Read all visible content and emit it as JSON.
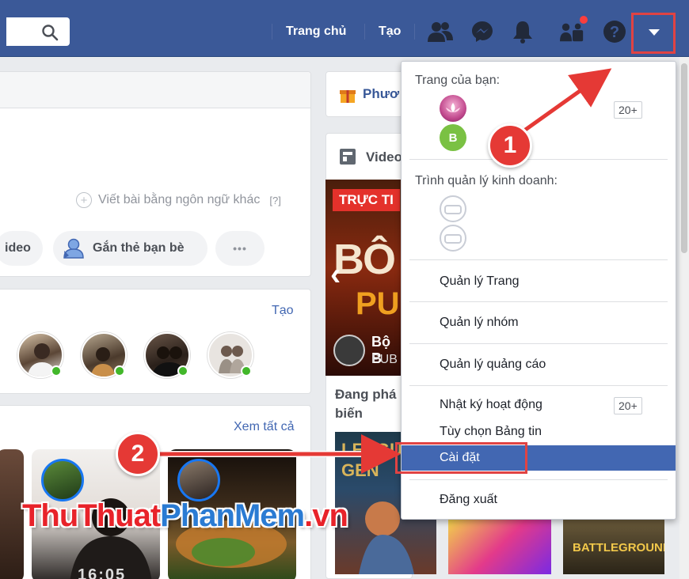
{
  "header": {
    "nav_home": "Trang chủ",
    "nav_create": "Tạo"
  },
  "composer": {
    "other_language": "Viết bài bằng ngôn ngữ khác",
    "help": "[?]",
    "video_partial": "ideo",
    "tag_friends": "Gắn thẻ bạn bè",
    "more": "•••"
  },
  "contacts": {
    "create_link": "Tạo"
  },
  "stories": {
    "see_all": "Xem tất cả",
    "timer_partial": "16:05"
  },
  "right_column": {
    "card1_title_partial": "Phươ",
    "card2_title_partial": "Video",
    "live_tag": "TRỰC TI",
    "live_title_partial": "BÔ B",
    "live_title_line2": "PU",
    "channel_partial": "Bộ B",
    "channel_sub_partial": "PUB",
    "trending_title": "Đang phá",
    "trending_title_line2": "biến"
  },
  "dropdown": {
    "your_pages_header": "Trang của bạn:",
    "page_count": "20+",
    "page2_initial": "B",
    "business_header": "Trình quản lý kinh doanh:",
    "items": [
      {
        "label": "Quản lý Trang"
      },
      {
        "label": "Quản lý nhóm"
      },
      {
        "label": "Quản lý quảng cáo"
      },
      {
        "label": "Nhật ký hoạt động"
      },
      {
        "label": "Tùy chọn Bảng tin"
      },
      {
        "label": "Cài đặt"
      },
      {
        "label": "Đăng xuất"
      }
    ],
    "activity_count": "20+"
  },
  "annotations": {
    "step1": "1",
    "step2": "2"
  },
  "watermark": {
    "part1": "ThuThuat",
    "part2": "PhanMem",
    "part3": ".vn"
  },
  "thumbnails": {
    "game3_title": "BATTLEGROUNDS",
    "game1_title_partial": "LEAGUE GEN"
  },
  "colors": {
    "brand": "#3b5998",
    "highlight": "#e04343",
    "active_item": "#4267b2"
  }
}
